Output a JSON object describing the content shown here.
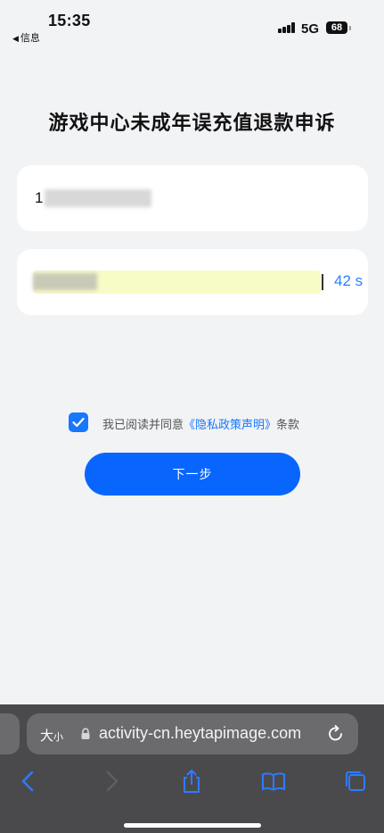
{
  "status_bar": {
    "back_label": "信息",
    "time": "15:35",
    "network": "5G",
    "battery": "68"
  },
  "page": {
    "title": "游戏中心未成年误充值退款申诉"
  },
  "form": {
    "phone_value_visible": "1",
    "code_countdown": "42 s"
  },
  "agreement": {
    "prefix": "我已阅读并同意",
    "link": "《隐私政策声明》",
    "suffix": "条款",
    "checked": true
  },
  "next_button": {
    "label": "下一步"
  },
  "browser": {
    "text_size_label": "大",
    "text_size_small": "小",
    "url": "activity-cn.heytapimage.com"
  },
  "colors": {
    "accent": "#0866ff",
    "link": "#1677ff",
    "background": "#f2f3f5",
    "browser_bar": "#4a4a4d"
  }
}
